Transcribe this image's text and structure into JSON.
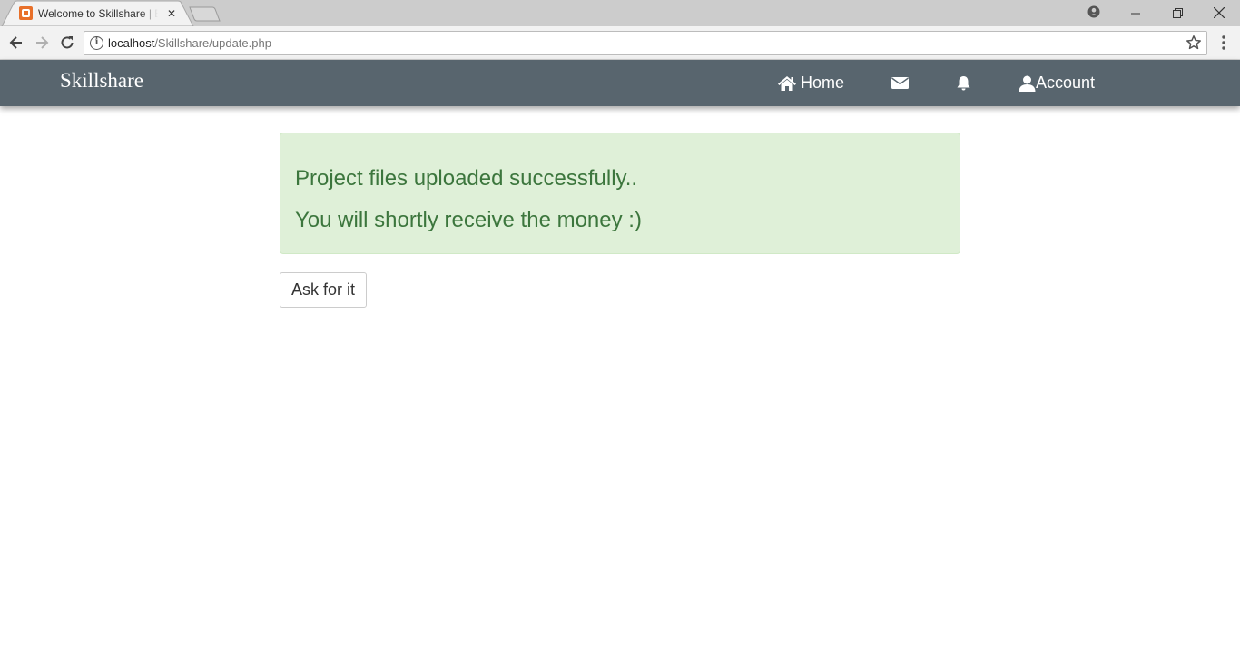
{
  "browser": {
    "tab_title": "Welcome to Skillshare | B",
    "tab_close": "✕",
    "url_host": "localhost",
    "url_path": "/Skillshare/update.php",
    "win_minimize": "—",
    "win_restore": "❐",
    "win_close": "✕",
    "icons": [
      "back-icon",
      "forward-icon",
      "reload-icon",
      "info-icon",
      "star-icon",
      "menu-icon",
      "profile-icon"
    ]
  },
  "navbar": {
    "brand": "Skillshare",
    "home_label": "Home",
    "account_label": "Account",
    "color": "#58656e"
  },
  "alert": {
    "line1": "Project files uploaded successfully..",
    "line2": "You will shortly receive the money :)",
    "bg_color": "#dff0d8",
    "text_color": "#3c763d"
  },
  "actions": {
    "ask_button": "Ask for it"
  }
}
